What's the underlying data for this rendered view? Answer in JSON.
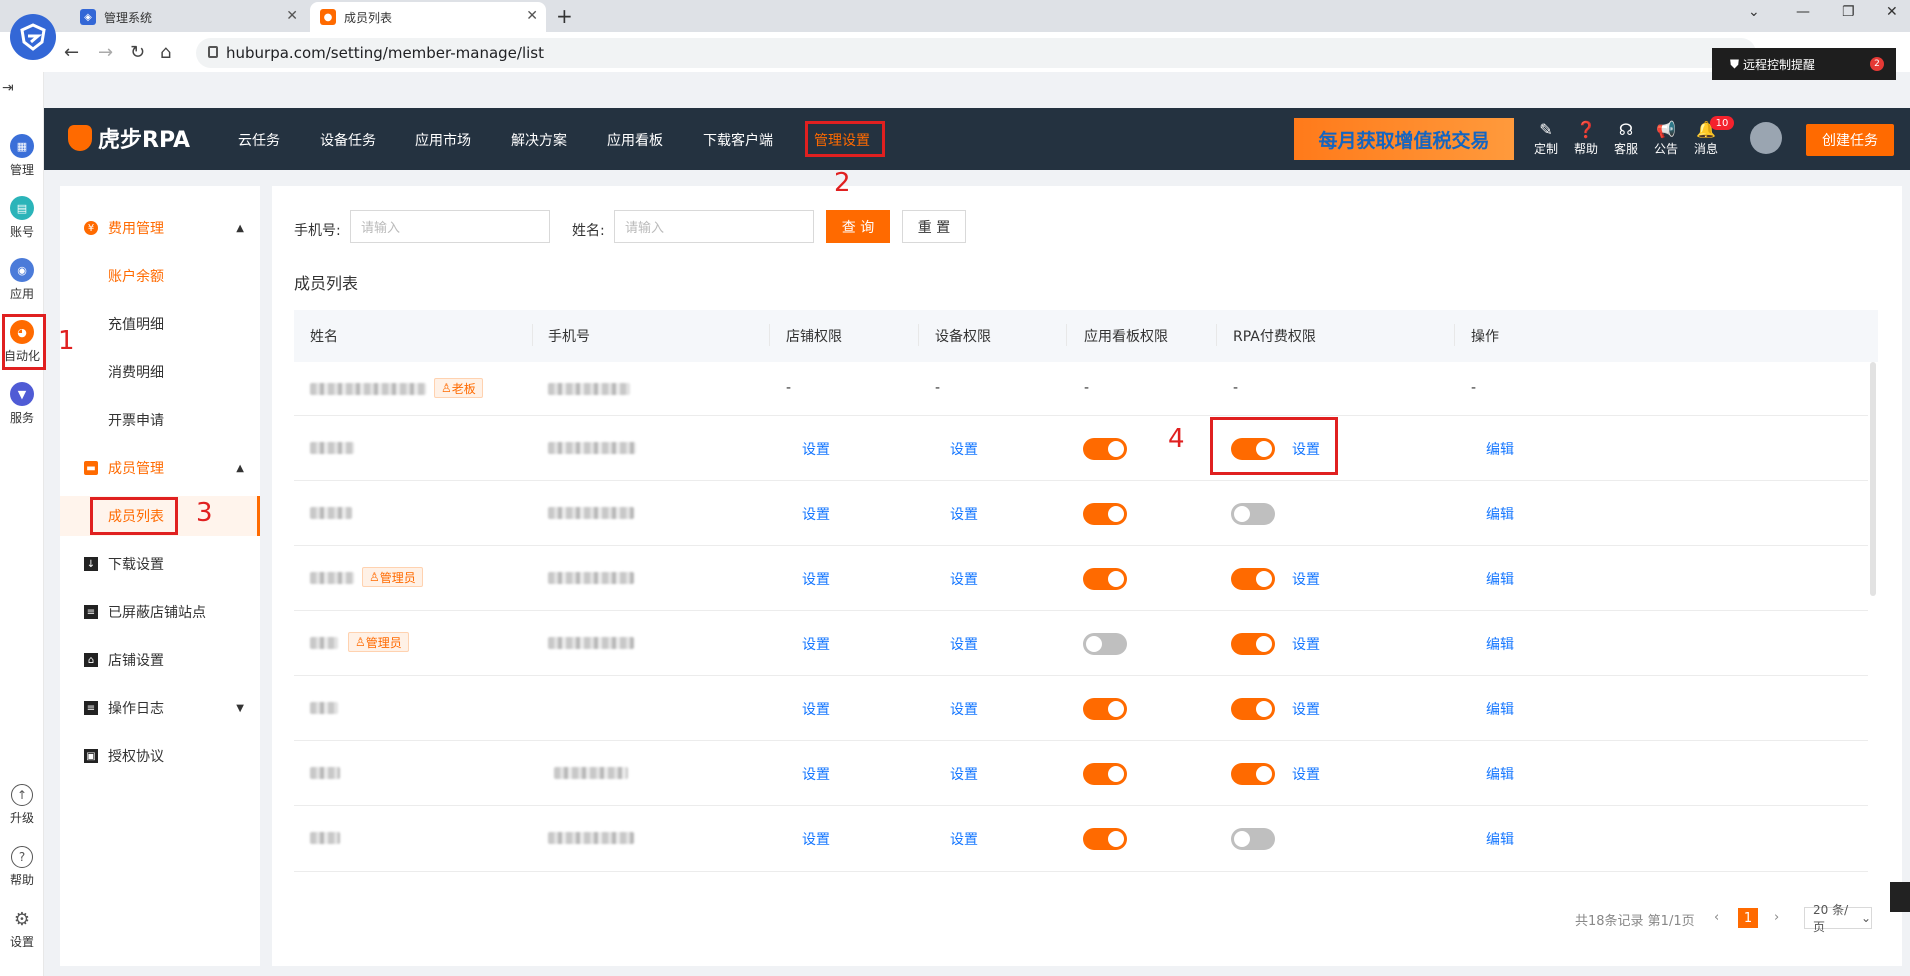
{
  "browser": {
    "tabs": [
      {
        "label": "管理系统",
        "active": false
      },
      {
        "label": "成员列表",
        "active": true
      }
    ],
    "url": "huburpa.com/setting/member-manage/list",
    "remote_notice": "远程控制提醒",
    "remote_badge": "2"
  },
  "rail": {
    "items": [
      {
        "label": "管理",
        "icon": "grid-icon",
        "color": "#3b6fd8"
      },
      {
        "label": "账号",
        "icon": "account-icon",
        "color": "#2bb4b9"
      },
      {
        "label": "应用",
        "icon": "app-icon",
        "color": "#4b7bd9"
      },
      {
        "label": "自动化",
        "icon": "tiger-icon",
        "color": "#ff6a00"
      },
      {
        "label": "服务",
        "icon": "tie-icon",
        "color": "#4f5bd5"
      }
    ],
    "bottom": [
      {
        "label": "升级",
        "icon": "upgrade-icon"
      },
      {
        "label": "帮助",
        "icon": "help-icon"
      },
      {
        "label": "设置",
        "icon": "gear-icon"
      }
    ]
  },
  "header": {
    "logo": "虎步RPA",
    "nav": [
      "云任务",
      "设备任务",
      "应用市场",
      "解决方案",
      "应用看板",
      "下载客户端",
      "管理设置"
    ],
    "active_nav": "管理设置",
    "banner": "每月获取增值税交易",
    "icons": [
      {
        "label": "定制",
        "icon": "edit-icon"
      },
      {
        "label": "帮助",
        "icon": "help-icon"
      },
      {
        "label": "客服",
        "icon": "headset-icon"
      },
      {
        "label": "公告",
        "icon": "megaphone-icon"
      },
      {
        "label": "消息",
        "icon": "bell-icon"
      }
    ],
    "message_count": "10",
    "create_button": "创建任务"
  },
  "menu": {
    "groups": [
      {
        "label": "费用管理",
        "items": [
          "账户余额",
          "充值明细",
          "消费明细",
          "开票申请"
        ]
      },
      {
        "label": "成员管理",
        "items": [
          "成员列表"
        ]
      }
    ],
    "others": [
      "下载设置",
      "已屏蔽店铺站点",
      "店铺设置",
      "操作日志",
      "授权协议"
    ],
    "selected": "成员列表"
  },
  "filters": {
    "phone_label": "手机号:",
    "phone_placeholder": "请输入",
    "name_label": "姓名:",
    "name_placeholder": "请输入",
    "query": "查 询",
    "reset": "重 置"
  },
  "section_title": "成员列表",
  "table": {
    "columns": [
      "姓名",
      "手机号",
      "店铺权限",
      "设备权限",
      "应用看板权限",
      "RPA付费权限",
      "操作"
    ],
    "rows": [
      {
        "role": "老板",
        "shop": "-",
        "device": "-",
        "board": "-",
        "rpa": "-",
        "op": "-"
      },
      {
        "role": "",
        "shop": "设置",
        "device": "设置",
        "board": true,
        "rpa": true,
        "rpa_link": "设置",
        "op": "编辑"
      },
      {
        "role": "",
        "shop": "设置",
        "device": "设置",
        "board": true,
        "rpa": false,
        "rpa_link": "",
        "op": "编辑"
      },
      {
        "role": "管理员",
        "shop": "设置",
        "device": "设置",
        "board": true,
        "rpa": true,
        "rpa_link": "设置",
        "op": "编辑"
      },
      {
        "role": "管理员",
        "shop": "设置",
        "device": "设置",
        "board": false,
        "rpa": true,
        "rpa_link": "设置",
        "op": "编辑"
      },
      {
        "role": "",
        "shop": "设置",
        "device": "设置",
        "board": true,
        "rpa": true,
        "rpa_link": "设置",
        "op": "编辑"
      },
      {
        "role": "",
        "shop": "设置",
        "device": "设置",
        "board": true,
        "rpa": true,
        "rpa_link": "设置",
        "op": "编辑"
      },
      {
        "role": "",
        "shop": "设置",
        "device": "设置",
        "board": true,
        "rpa": false,
        "rpa_link": "",
        "op": "编辑"
      }
    ]
  },
  "pagination": {
    "summary": "共18条记录 第1/1页",
    "current": "1",
    "page_size": "20 条/页"
  },
  "annotations": [
    "1",
    "2",
    "3",
    "4"
  ],
  "colors": {
    "accent": "#ff6a00",
    "header_bg": "#243240",
    "link": "#1677ff",
    "annotation": "#e02020"
  }
}
